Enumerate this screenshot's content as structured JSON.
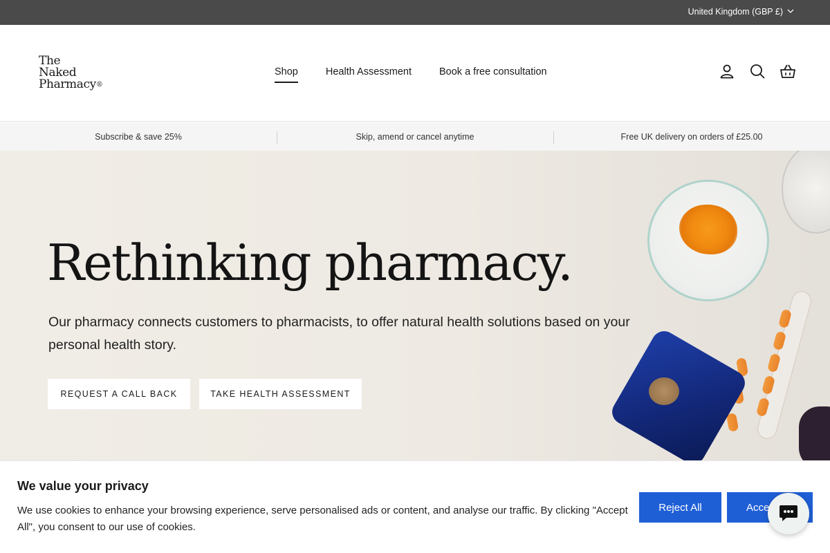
{
  "topbar": {
    "country_label": "United Kingdom (GBP £)"
  },
  "header": {
    "logo": {
      "line1": "The",
      "line2": "Naked",
      "line3": "Pharmacy",
      "reg": "®"
    },
    "nav": [
      {
        "label": "Shop",
        "active": true
      },
      {
        "label": "Health Assessment",
        "active": false
      },
      {
        "label": "Book a free consultation",
        "active": false
      }
    ],
    "icons": [
      "account-icon",
      "search-icon",
      "basket-icon"
    ]
  },
  "usp": [
    "Subscribe & save 25%",
    "Skip, amend or cancel anytime",
    "Free UK delivery on orders of £25.00"
  ],
  "hero": {
    "title": "Rethinking pharmacy.",
    "description": "Our pharmacy connects customers to pharmacists, to offer natural health solutions based on your personal health story.",
    "buttons": {
      "callback": "REQUEST A CALL BACK",
      "assessment": "TAKE HEALTH ASSESSMENT"
    }
  },
  "cookie": {
    "title": "We value your privacy",
    "text": "We use cookies to enhance your browsing experience, serve personalised ads or content, and analyse our traffic. By clicking \"Accept All\", you consent to our use of cookies.",
    "reject_label": "Reject All",
    "accept_label": "Accept All"
  },
  "colors": {
    "topbar": "#4a4a4a",
    "primary_button": "#1f5fd6",
    "usp_background": "#f5f5f5"
  }
}
